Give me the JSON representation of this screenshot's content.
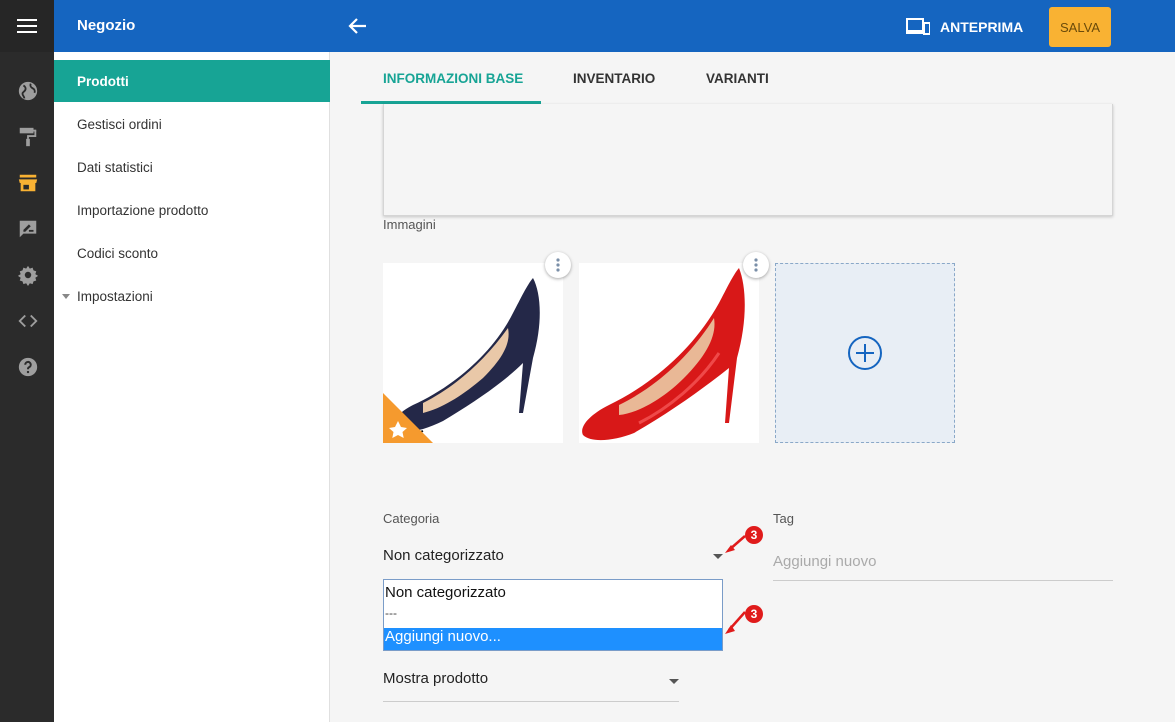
{
  "rail": {
    "icons": [
      "menu-icon",
      "globe-icon",
      "paint-roller-icon",
      "store-icon",
      "feedback-icon",
      "gear-icon",
      "code-icon",
      "help-icon"
    ],
    "active_color": "#f9b233"
  },
  "header": {
    "title": "Negozio",
    "preview_label": "ANTEPRIMA",
    "save_label": "SALVA"
  },
  "sidebar": {
    "items": [
      {
        "label": "Prodotti"
      },
      {
        "label": "Gestisci ordini"
      },
      {
        "label": "Dati statistici"
      },
      {
        "label": "Importazione prodotto"
      },
      {
        "label": "Codici sconto"
      },
      {
        "label": "Impostazioni"
      }
    ]
  },
  "tabs": [
    {
      "label": "INFORMAZIONI BASE"
    },
    {
      "label": "INVENTARIO"
    },
    {
      "label": "VARIANTI"
    }
  ],
  "images": {
    "label": "Immagini"
  },
  "category": {
    "label": "Categoria",
    "value": "Non categorizzato",
    "options": [
      "Non categorizzato",
      "---",
      "Aggiungi nuovo..."
    ],
    "selected_option": "Aggiungi nuovo..."
  },
  "tag": {
    "label": "Tag",
    "placeholder": "Aggiungi nuovo"
  },
  "visibility": {
    "value": "Mostra prodotto"
  },
  "annotations": {
    "badge_1": "3",
    "badge_2": "3"
  },
  "colors": {
    "header": "#1565c0",
    "accent": "#17a495",
    "save": "#f9b233"
  }
}
